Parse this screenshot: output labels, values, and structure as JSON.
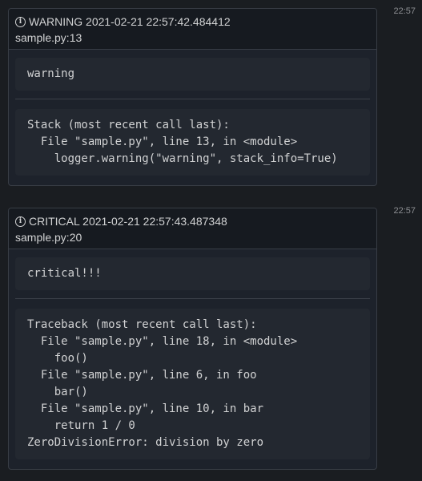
{
  "messages": [
    {
      "time": "22:57",
      "header": "WARNING 2021-02-21 22:57:42.484412",
      "location": "sample.py:13",
      "message": "warning",
      "trace": "Stack (most recent call last):\n  File \"sample.py\", line 13, in <module>\n    logger.warning(\"warning\", stack_info=True)"
    },
    {
      "time": "22:57",
      "header": "CRITICAL 2021-02-21 22:57:43.487348",
      "location": "sample.py:20",
      "message": "critical!!!",
      "trace": "Traceback (most recent call last):\n  File \"sample.py\", line 18, in <module>\n    foo()\n  File \"sample.py\", line 6, in foo\n    bar()\n  File \"sample.py\", line 10, in bar\n    return 1 / 0\nZeroDivisionError: division by zero"
    }
  ],
  "icons": {
    "info": "info-circle-icon",
    "info_glyph": "i"
  },
  "colors": {
    "background": "#1a1d21",
    "card": "#1d222b",
    "code_bg": "#232830",
    "border": "#383d45",
    "text": "#d1d2d3",
    "timestamp": "#8c8e92"
  }
}
